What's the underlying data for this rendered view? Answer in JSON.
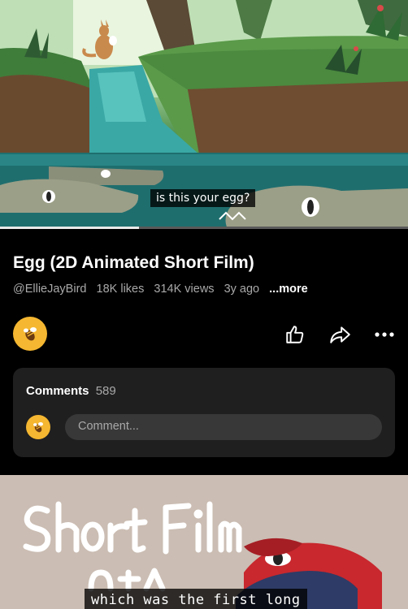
{
  "video1": {
    "caption": "is this your egg?",
    "progress_fraction": 0.34
  },
  "info": {
    "title": "Egg (2D Animated Short Film)",
    "channel": "@EllieJayBird",
    "likes": "18K likes",
    "views": "314K views",
    "age": "3y ago",
    "more": "...more"
  },
  "actions": {
    "icons": [
      "thumbs-up-icon",
      "share-icon",
      "more-options-icon"
    ]
  },
  "comments": {
    "label": "Comments",
    "count": "589",
    "placeholder": "Comment..."
  },
  "video2": {
    "caption": "which was the first long"
  },
  "colors": {
    "background": "#000000",
    "avatar": "#f5b731",
    "card": "#1f1f1f",
    "input": "#383838",
    "muted_text": "#a9a9a9"
  }
}
